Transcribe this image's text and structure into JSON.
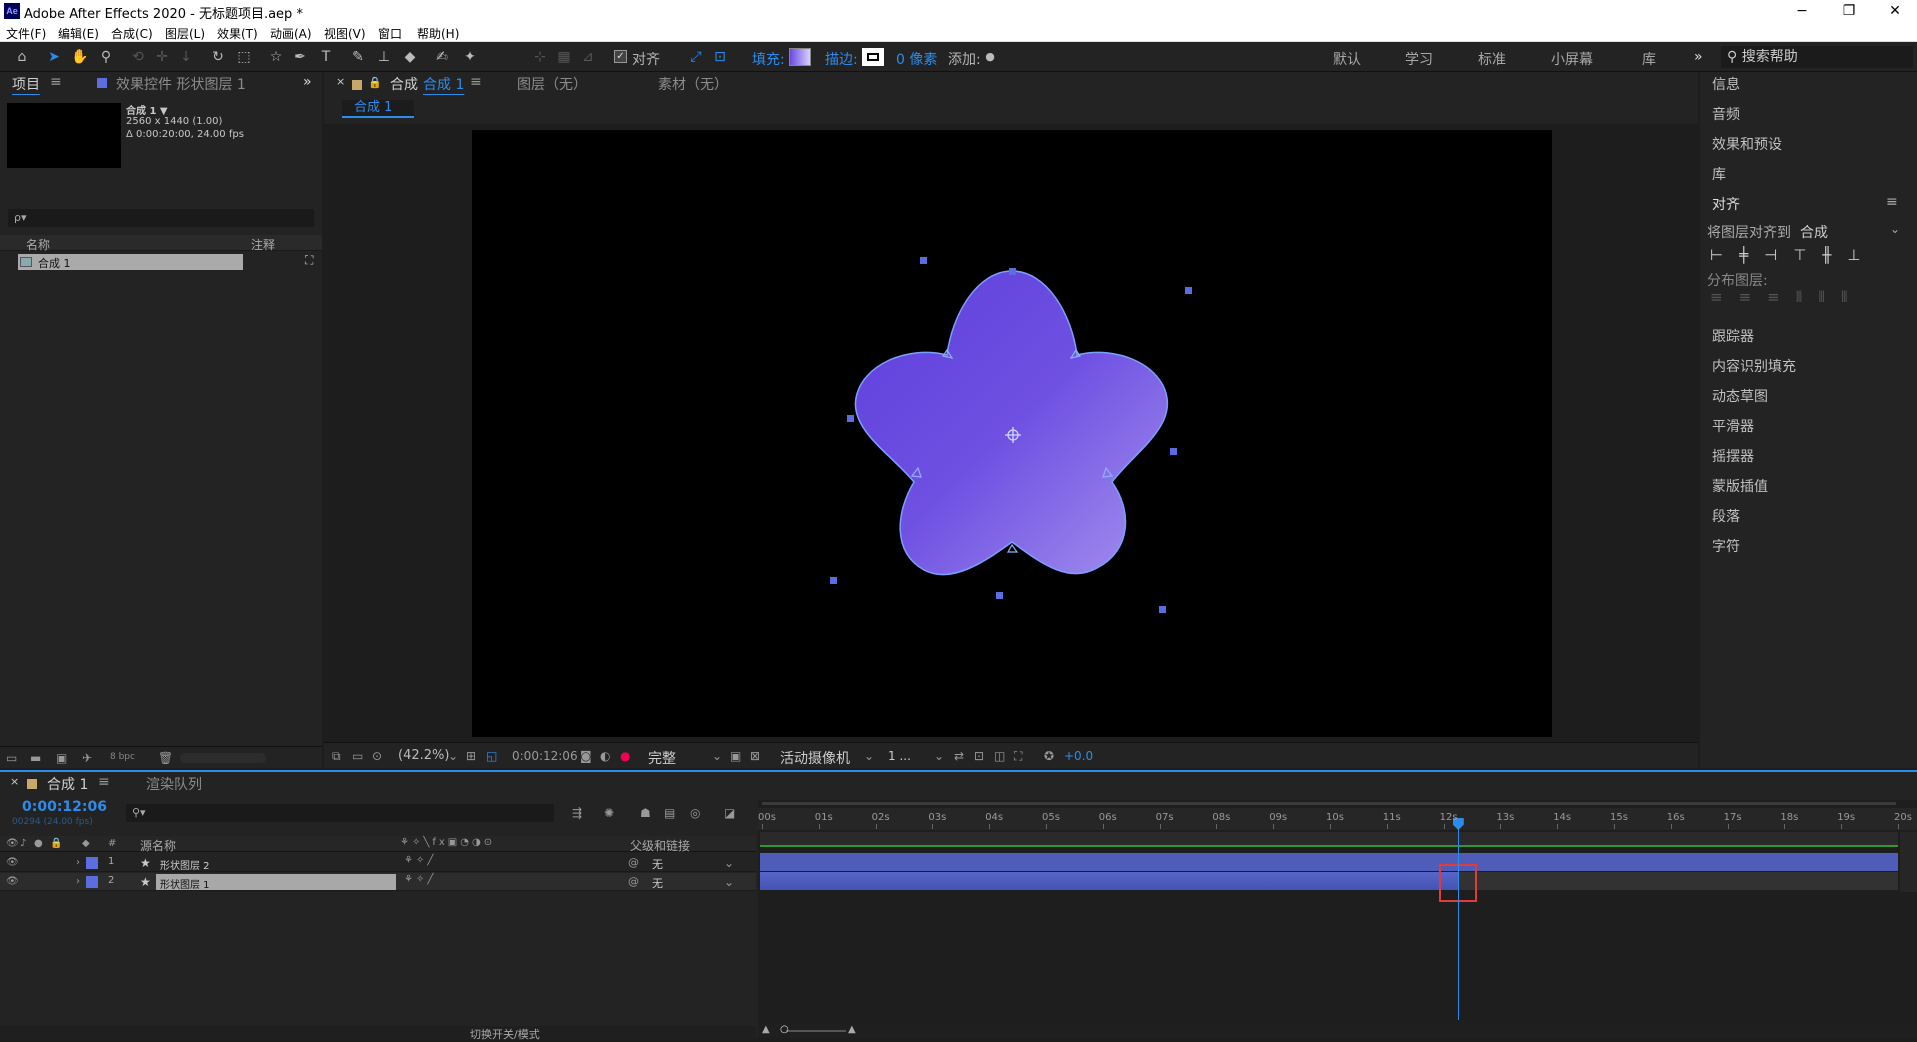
{
  "titlebar": {
    "app_icon": "Ae",
    "title": "Adobe After Effects 2020 - 无标题项目.aep *",
    "minimize": "−",
    "maximize": "❐",
    "close": "✕"
  },
  "menu": [
    "文件(F)",
    "编辑(E)",
    "合成(C)",
    "图层(L)",
    "效果(T)",
    "动画(A)",
    "视图(V)",
    "窗口",
    "帮助(H)"
  ],
  "toolbar": {
    "align_label": "对齐",
    "fill_label": "填充:",
    "stroke_label": "描边:",
    "stroke_px": "0 像素",
    "add_label": "添加:",
    "workspaces": [
      "默认",
      "学习",
      "标准",
      "小屏幕",
      "库"
    ],
    "more": "»",
    "help_search": "搜索帮助"
  },
  "project": {
    "tab_project": "项目",
    "tab_effects": "效果控件 形状图层 1",
    "comp_name": "合成 1 ▼",
    "comp_size": "2560 x 1440 (1.00)",
    "comp_duration": "Δ 0:00:20:00, 24.00 fps",
    "search_placeholder": "ρ▾",
    "col_name": "名称",
    "col_comment": "注释",
    "item": "合成 1",
    "bpc": "8 bpc"
  },
  "viewer": {
    "tab_comp_prefix": "合成",
    "tab_comp_name": "合成 1",
    "tab_layer": "图层（无）",
    "tab_footage": "素材（无）",
    "breadcrumb": "合成 1",
    "zoom": "(42.2%)",
    "timecode": "0:00:12:06",
    "quality": "完整",
    "camera": "活动摄像机",
    "views": "1 ...",
    "exposure": "+0.0"
  },
  "right_panel": {
    "items_top": [
      "信息",
      "音频",
      "效果和预设",
      "库"
    ],
    "align_title": "对齐",
    "align_to_label": "将图层对齐到",
    "align_to_value": "合成",
    "distribute_label": "分布图层:",
    "items_bottom": [
      "跟踪器",
      "内容识别填充",
      "动态草图",
      "平滑器",
      "摇摆器",
      "蒙版插值",
      "段落",
      "字符"
    ]
  },
  "timeline": {
    "tab_comp": "合成 1",
    "tab_render": "渲染队列",
    "timecode": "0:00:12:06",
    "frames": "00294 (24.00 fps)",
    "col_source": "源名称",
    "col_parent": "父级和链接",
    "layers": [
      {
        "num": "1",
        "name": "形状图层 2",
        "parent": "无"
      },
      {
        "num": "2",
        "name": "形状图层 1",
        "parent": "无"
      }
    ],
    "ruler": [
      "00s",
      "01s",
      "02s",
      "03s",
      "04s",
      "05s",
      "06s",
      "07s",
      "08s",
      "09s",
      "10s",
      "11s",
      "12s",
      "13s",
      "14s",
      "15s",
      "16s",
      "17s",
      "18s",
      "19s",
      "20s"
    ],
    "footer": "切换开关/模式",
    "playhead_time_s": 12.25,
    "layer2_bar_end_s": 12.25
  },
  "colors": {
    "accent": "#2d8ceb",
    "shape_fill_start": "#6a4ae0",
    "shape_fill_end": "#9d86ec",
    "handle": "#5a6ee0",
    "highlight_box": "#e03c3c"
  }
}
